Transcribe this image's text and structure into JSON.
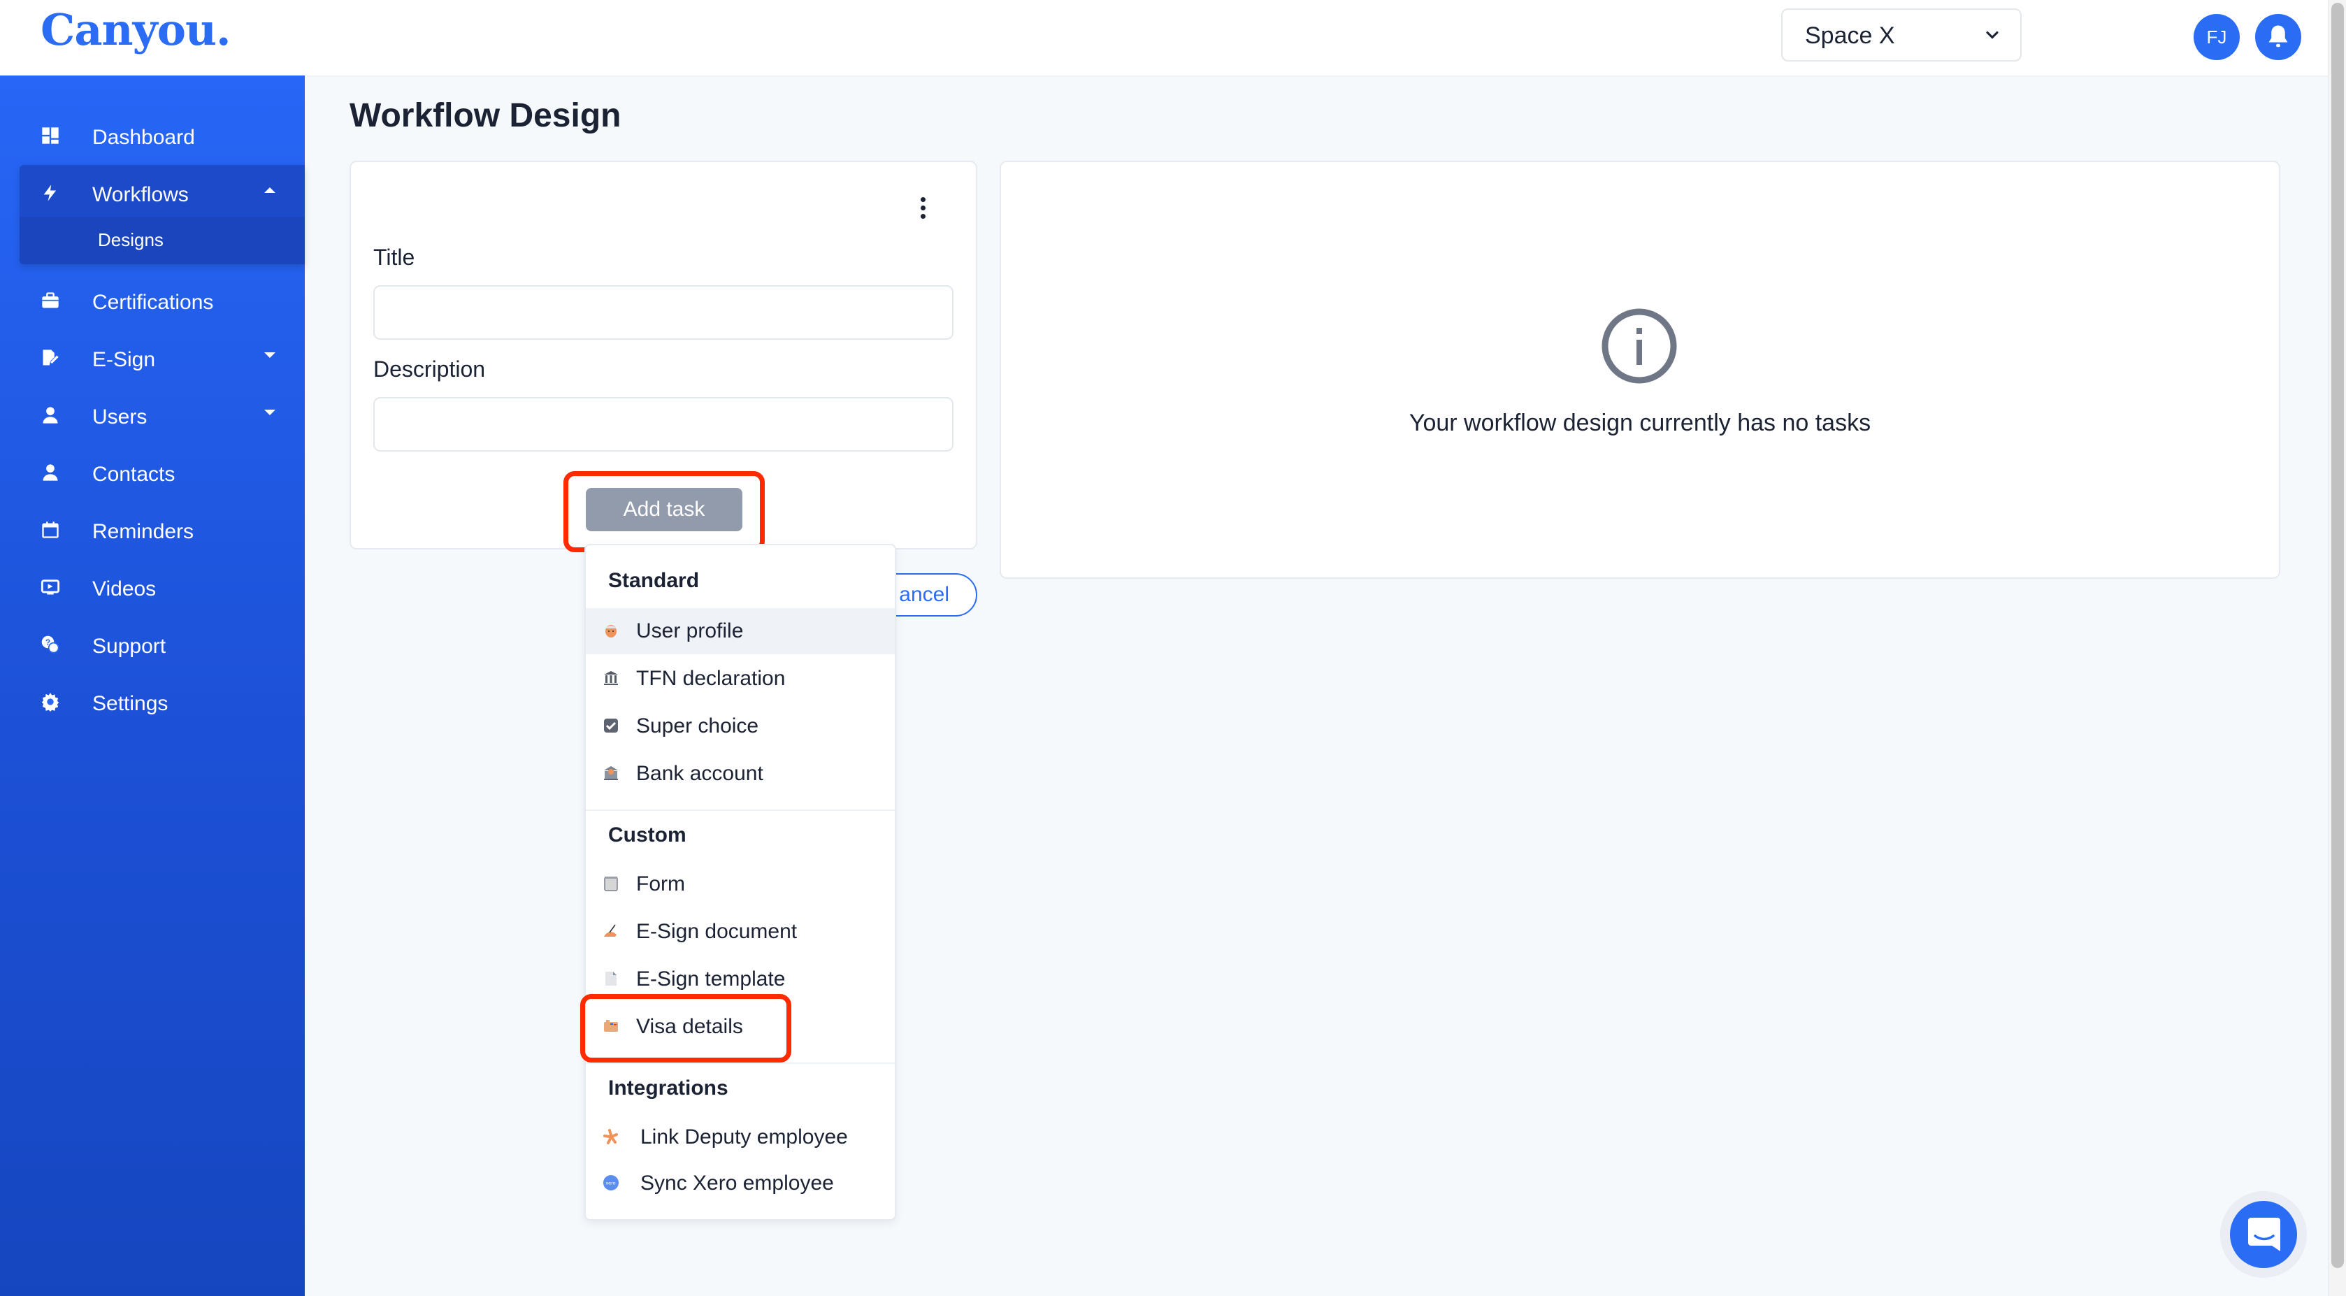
{
  "app": {
    "logo": "Canyou."
  },
  "header": {
    "space_select": {
      "value": "Space X"
    },
    "avatar_initials": "FJ",
    "icons": {
      "chevron": "chevron-down-icon",
      "notifications": "bell-icon"
    }
  },
  "sidebar": {
    "items": [
      {
        "label": "Dashboard",
        "icon": "dashboard-icon"
      },
      {
        "label": "Workflows",
        "icon": "bolt-icon",
        "expanded": true,
        "children": [
          {
            "label": "Designs",
            "active": true
          }
        ]
      },
      {
        "label": "Certifications",
        "icon": "briefcase-icon"
      },
      {
        "label": "E-Sign",
        "icon": "signature-icon",
        "has_submenu": true
      },
      {
        "label": "Users",
        "icon": "user-icon",
        "has_submenu": true
      },
      {
        "label": "Contacts",
        "icon": "user-icon"
      },
      {
        "label": "Reminders",
        "icon": "calendar-icon"
      },
      {
        "label": "Videos",
        "icon": "video-icon"
      },
      {
        "label": "Support",
        "icon": "support-chat-icon"
      },
      {
        "label": "Settings",
        "icon": "gear-icon"
      }
    ]
  },
  "page": {
    "title": "Workflow Design",
    "form": {
      "title_label": "Title",
      "title_value": "",
      "description_label": "Description",
      "description_value": "",
      "add_task_label": "Add task",
      "cancel_label": "Cancel",
      "cancel_visible_text": "ancel"
    },
    "empty_state": {
      "icon": "info-icon",
      "message": "Your workflow design currently has no tasks"
    }
  },
  "task_menu": {
    "sections": [
      {
        "heading": "Standard",
        "items": [
          {
            "label": "User profile",
            "icon": "user-profile-icon",
            "hovered": true
          },
          {
            "label": "TFN declaration",
            "icon": "bank-building-icon"
          },
          {
            "label": "Super choice",
            "icon": "checkbox-icon"
          },
          {
            "label": "Bank account",
            "icon": "bank-dollar-icon"
          }
        ]
      },
      {
        "heading": "Custom",
        "items": [
          {
            "label": "Form",
            "icon": "form-icon"
          },
          {
            "label": "E-Sign document",
            "icon": "hand-writing-icon"
          },
          {
            "label": "E-Sign template",
            "icon": "document-template-icon"
          },
          {
            "label": "Visa details",
            "icon": "passport-icon",
            "highlighted": true
          }
        ]
      },
      {
        "heading": "Integrations",
        "items": [
          {
            "label": "Link Deputy employee",
            "icon": "deputy-logo-icon"
          },
          {
            "label": "Sync Xero employee",
            "icon": "xero-logo-icon"
          }
        ]
      }
    ]
  },
  "colors": {
    "brand": "#2a6df4",
    "highlight": "#ff2a00",
    "button_disabled": "#929bab"
  }
}
